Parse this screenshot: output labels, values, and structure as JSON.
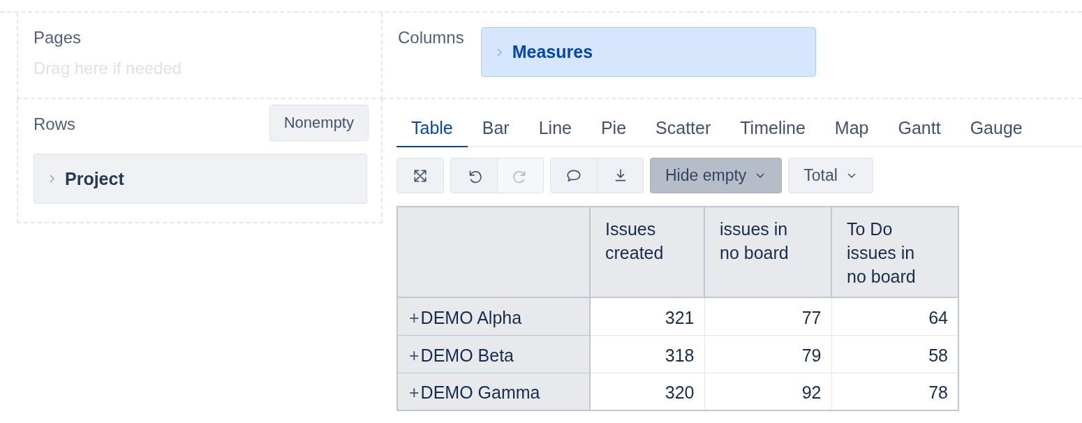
{
  "pages": {
    "label": "Pages",
    "hint": "Drag here if needed"
  },
  "columns": {
    "label": "Columns",
    "chips": [
      {
        "label": "Measures",
        "expanded": false
      }
    ]
  },
  "rows": {
    "label": "Rows",
    "nonempty_button": "Nonempty",
    "chips": [
      {
        "label": "Project",
        "expanded": false
      }
    ]
  },
  "tabs": [
    {
      "label": "Table",
      "selected": true
    },
    {
      "label": "Bar",
      "selected": false
    },
    {
      "label": "Line",
      "selected": false
    },
    {
      "label": "Pie",
      "selected": false
    },
    {
      "label": "Scatter",
      "selected": false
    },
    {
      "label": "Timeline",
      "selected": false
    },
    {
      "label": "Map",
      "selected": false
    },
    {
      "label": "Gantt",
      "selected": false
    },
    {
      "label": "Gauge",
      "selected": false
    }
  ],
  "toolbar": [
    {
      "kind": "icons",
      "buttons": [
        {
          "disabled": false
        }
      ]
    },
    {
      "kind": "icons",
      "buttons": [
        {
          "disabled": false
        },
        {
          "disabled": true
        }
      ]
    },
    {
      "kind": "icons",
      "buttons": [
        {
          "disabled": false
        },
        {
          "disabled": false
        }
      ]
    },
    {
      "kind": "dropdown",
      "label": "Hide empty",
      "pressed": true
    },
    {
      "kind": "dropdown",
      "label": "Total",
      "pressed": false
    }
  ],
  "table": {
    "columns": [
      "",
      "Issues created",
      "issues in no board",
      "To Do issues in no board"
    ],
    "rows": [
      {
        "expander": "+",
        "label": "DEMO Alpha",
        "values": [
          "321",
          "77",
          "64"
        ]
      },
      {
        "expander": "+",
        "label": "DEMO Beta",
        "values": [
          "318",
          "79",
          "58"
        ]
      },
      {
        "expander": "+",
        "label": "DEMO Gamma",
        "values": [
          "320",
          "92",
          "78"
        ]
      }
    ]
  }
}
